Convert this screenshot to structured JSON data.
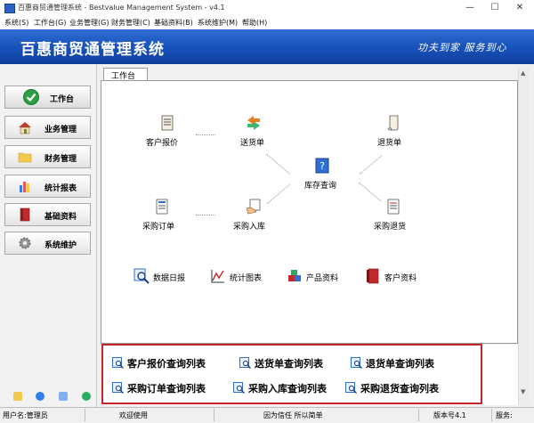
{
  "window": {
    "title": "百惠商贸通管理系统 - Bestvalue Management System - v4.1",
    "minimize": "—",
    "maximize": "☐",
    "close": "✕"
  },
  "menu": [
    "系统(S)",
    "工作台(G)",
    "业务管理(G)",
    "财务管理(C)",
    "基础资料(B)",
    "系统维护(M)",
    "帮助(H)"
  ],
  "banner": {
    "app_title": "百惠商贸通管理系统",
    "slogan": "功夫到家 服务到心"
  },
  "sidebar": [
    {
      "label": "工作台",
      "icon": "check-circle-icon"
    },
    {
      "label": "业务管理",
      "icon": "house-icon"
    },
    {
      "label": "财务管理",
      "icon": "folder-icon"
    },
    {
      "label": "统计报表",
      "icon": "bar-chart-icon"
    },
    {
      "label": "基础资料",
      "icon": "book-icon"
    },
    {
      "label": "系统维护",
      "icon": "gear-icon"
    }
  ],
  "tab": {
    "label": "工作台"
  },
  "workflow": {
    "quote": "客户报价",
    "delivery": "送货单",
    "inventory": "库存查询",
    "return": "退货单",
    "purchase_order": "采购订单",
    "purchase_in": "采购入库",
    "purchase_return": "采购退货"
  },
  "tools": [
    {
      "label": "数据日报",
      "icon": "magnifier-icon"
    },
    {
      "label": "统计图表",
      "icon": "line-chart-icon"
    },
    {
      "label": "产品资料",
      "icon": "cubes-icon"
    },
    {
      "label": "客户资料",
      "icon": "red-book-icon"
    }
  ],
  "queries": [
    {
      "label": "客户报价查询列表"
    },
    {
      "label": "送货单查询列表"
    },
    {
      "label": "退货单查询列表"
    },
    {
      "label": "采购订单查询列表"
    },
    {
      "label": "采购入库查询列表"
    },
    {
      "label": "采购退货查询列表"
    }
  ],
  "status": {
    "user": "用户名:管理员",
    "welcome": "欢迎使用",
    "motto": "因为信任 所以简单",
    "version": "版本号4.1",
    "service": "服务:"
  },
  "colors": {
    "banner": "#1650b8",
    "highlight_box": "#c0282b"
  }
}
